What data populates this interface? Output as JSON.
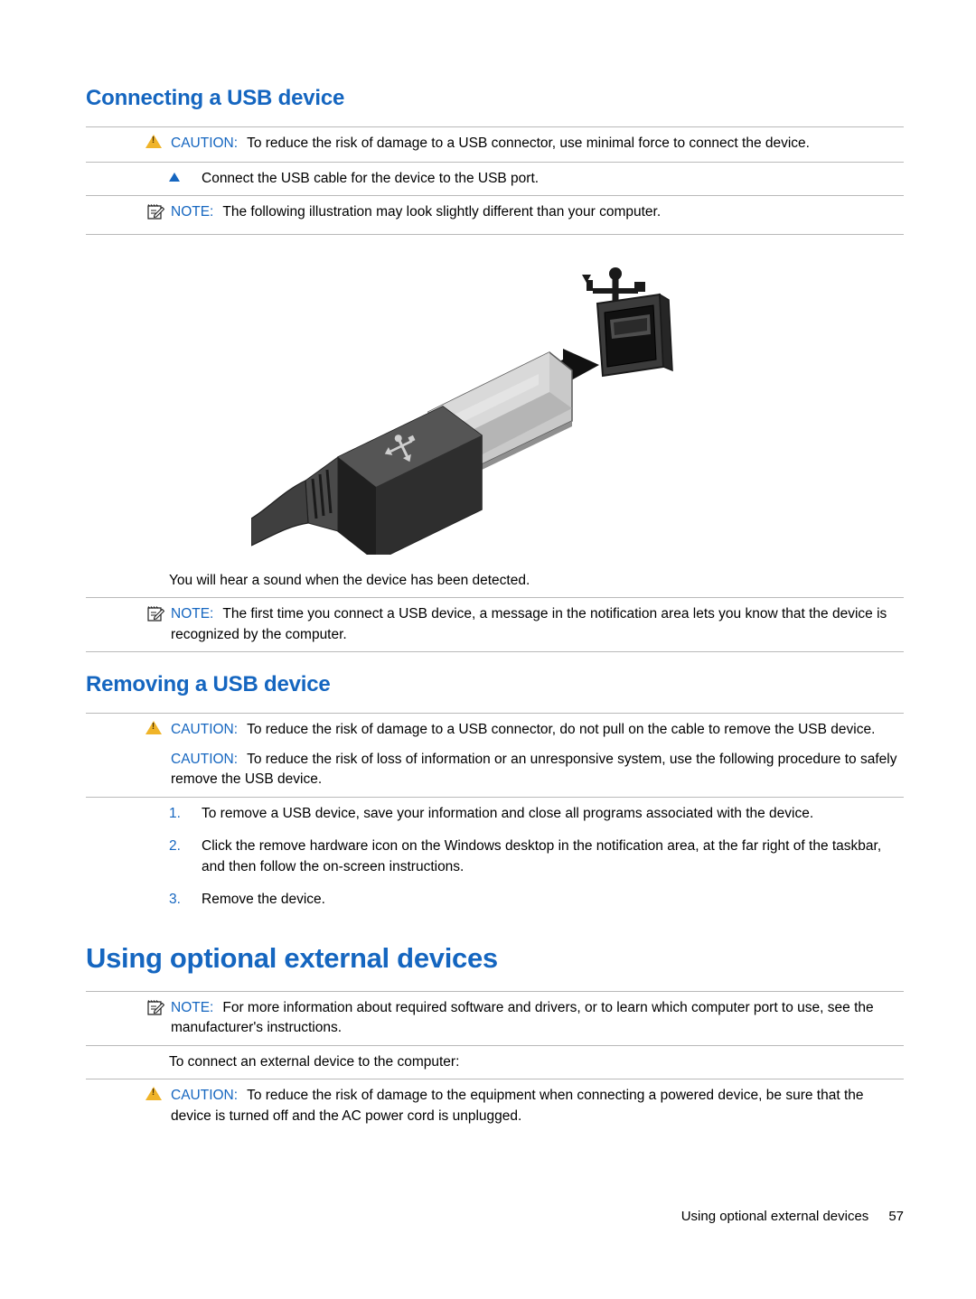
{
  "document": {
    "sections": [
      {
        "id": "connecting-usb",
        "title": "Connecting a USB device"
      },
      {
        "id": "removing-usb",
        "title": "Removing a USB device"
      }
    ],
    "chapter_title": "Using optional external devices",
    "labels": {
      "caution": "CAUTION:",
      "note": "NOTE:"
    },
    "blocks": {
      "caution_connect": "To reduce the risk of damage to a USB connector, use minimal force to connect the device.",
      "step_connect": "Connect the USB cable for the device to the USB port.",
      "note_illustration": "The following illustration may look slightly different than your computer.",
      "sound_detected": "You will hear a sound when the device has been detected.",
      "note_first_time": "The first time you connect a USB device, a message in the notification area lets you know that the device is recognized by the computer.",
      "caution_remove_cable": "To reduce the risk of damage to a USB connector, do not pull on the cable to remove the USB device.",
      "caution_remove_procedure": "To reduce the risk of loss of information or an unresponsive system, use the following procedure to safely remove the USB device.",
      "note_manufacturer": "For more information about required software and drivers, or to learn which computer port to use, see the manufacturer's instructions.",
      "connect_external_intro": "To connect an external device to the computer:",
      "caution_powered_device": "To reduce the risk of damage to the equipment when connecting a powered device, be sure that the device is turned off and the AC power cord is unplugged."
    },
    "removal_steps": [
      {
        "num": "1.",
        "text": "To remove a USB device, save your information and close all programs associated with the device."
      },
      {
        "num": "2.",
        "text": "Click the remove hardware icon on the Windows desktop in the notification area, at the far right of the taskbar, and then follow the on-screen instructions."
      },
      {
        "num": "3.",
        "text": "Remove the device."
      }
    ],
    "figure": {
      "name": "usb-cable-and-port-illustration",
      "alt": "Illustration of a USB cable connector being inserted into a USB port, with a USB trident symbol above the port"
    },
    "footer": {
      "text": "Using optional external devices",
      "page_number": "57"
    },
    "colors": {
      "heading": "#1566c0",
      "caution_icon": "#f0b429",
      "rule": "#b9b9b9"
    }
  }
}
